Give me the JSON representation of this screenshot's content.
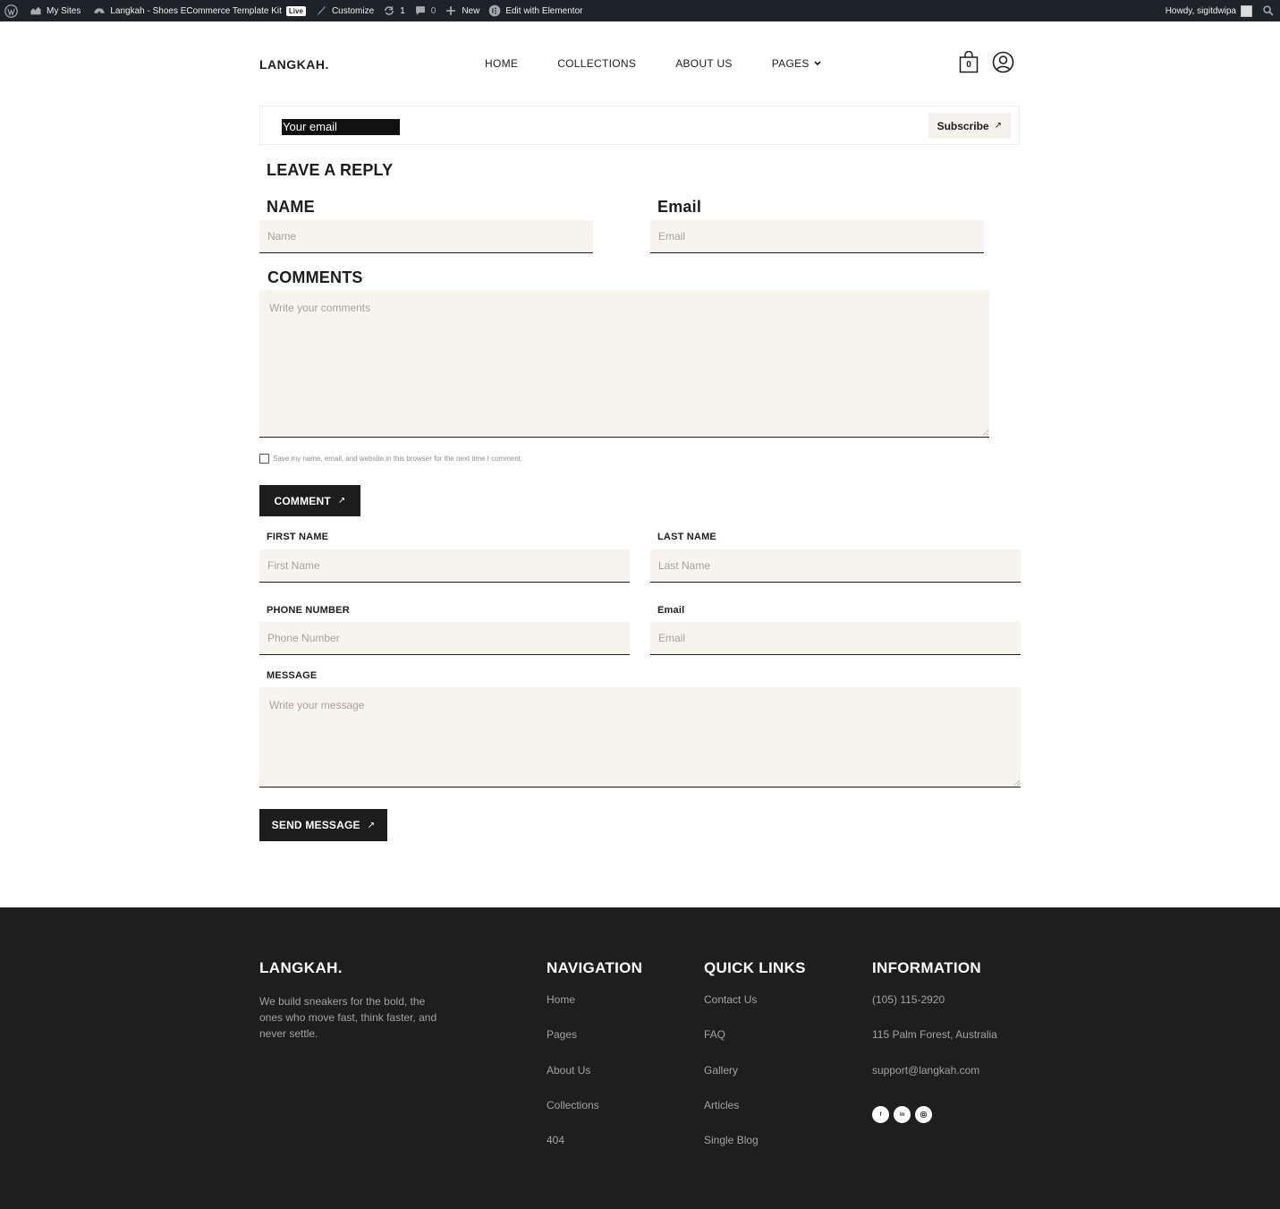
{
  "adminbar": {
    "my_sites": "My Sites",
    "site_name": "Langkah - Shoes ECommerce Template Kit",
    "live": "Live",
    "customize": "Customize",
    "updates": "1",
    "comments": "0",
    "new": "New",
    "elementor": "Edit with Elementor",
    "howdy": "Howdy, sigitdwipa"
  },
  "header": {
    "logo": "LANGKAH.",
    "nav": [
      "HOME",
      "COLLECTIONS",
      "ABOUT US",
      "PAGES"
    ],
    "cart_count": "0"
  },
  "subscribe": {
    "input_value": "Your email",
    "button": "Subscribe"
  },
  "reply": {
    "heading": "LEAVE A REPLY",
    "name_label": "NAME",
    "name_placeholder": "Name",
    "email_label": "Email",
    "email_placeholder": "Email",
    "comments_label": "COMMENTS",
    "comments_placeholder": "Write your comments",
    "save_text": "Save my name, email, and website in this browser for the next time I comment.",
    "button": "COMMENT"
  },
  "contact": {
    "first_label": "FIRST NAME",
    "first_placeholder": "First Name",
    "last_label": "LAST NAME",
    "last_placeholder": "Last Name",
    "phone_label": "PHONE NUMBER",
    "phone_placeholder": "Phone Number",
    "email_label": "Email",
    "email_placeholder": "Email",
    "message_label": "MESSAGE",
    "message_placeholder": "Write your message",
    "button": "SEND MESSAGE"
  },
  "footer": {
    "logo": "LANGKAH.",
    "description": "We build sneakers for the bold, the ones who move fast, think faster, and never settle.",
    "navigation": {
      "title": "NAVIGATION",
      "links": [
        "Home",
        "Pages",
        "About Us",
        "Collections",
        "404"
      ]
    },
    "quick_links": {
      "title": "QUICK LINKS",
      "links": [
        "Contact Us",
        "FAQ",
        "Gallery",
        "Articles",
        "Single Blog"
      ]
    },
    "information": {
      "title": "INFORMATION",
      "phone": "(105) 115-2920",
      "address": "115 Palm Forest, Australia",
      "email": "support@langkah.com"
    },
    "social": [
      "facebook-icon",
      "linkedin-icon",
      "instagram-icon"
    ]
  },
  "colors": {
    "dark": "#1d1d1d",
    "field_bg": "#f7f3ef",
    "footer_bg": "#1e1e1e",
    "adminbar_bg": "#1d2327"
  }
}
